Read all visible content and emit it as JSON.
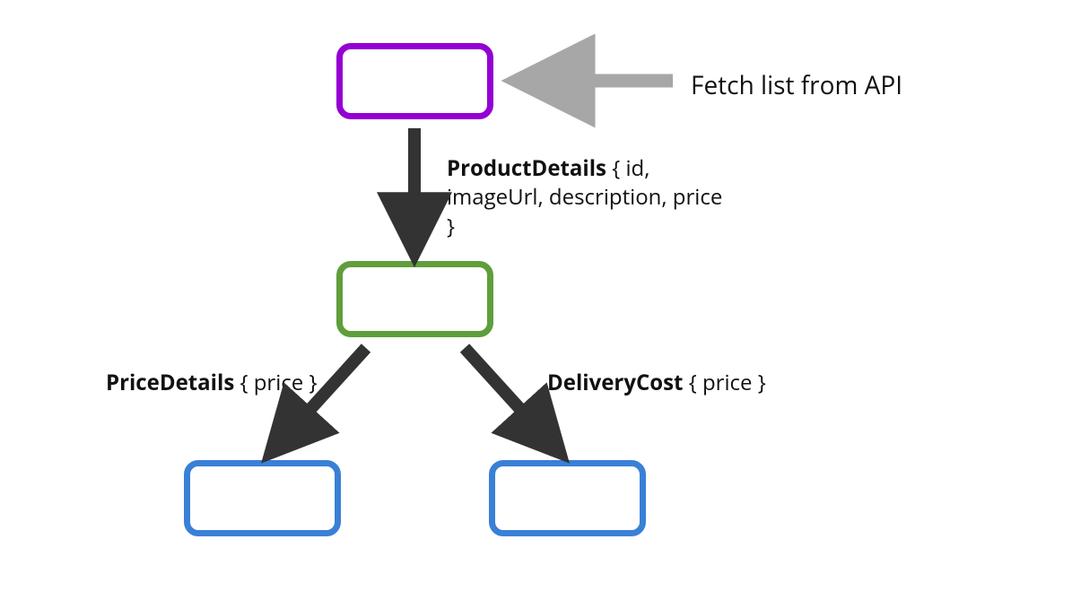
{
  "annotation": {
    "fetch": "Fetch list from API"
  },
  "labels": {
    "product": {
      "bold": "ProductDetails",
      "rest": " { id, imageUrl, description, price }"
    },
    "price": {
      "bold": "PriceDetails",
      "rest": " { price }"
    },
    "delivery": {
      "bold": "DeliveryCost",
      "rest": " { price }"
    }
  },
  "colors": {
    "purple": "#9400d3",
    "green": "#5f9e3b",
    "blue": "#3980d6",
    "arrowGrey": "#a7a7a7",
    "arrowDark": "#333333"
  }
}
